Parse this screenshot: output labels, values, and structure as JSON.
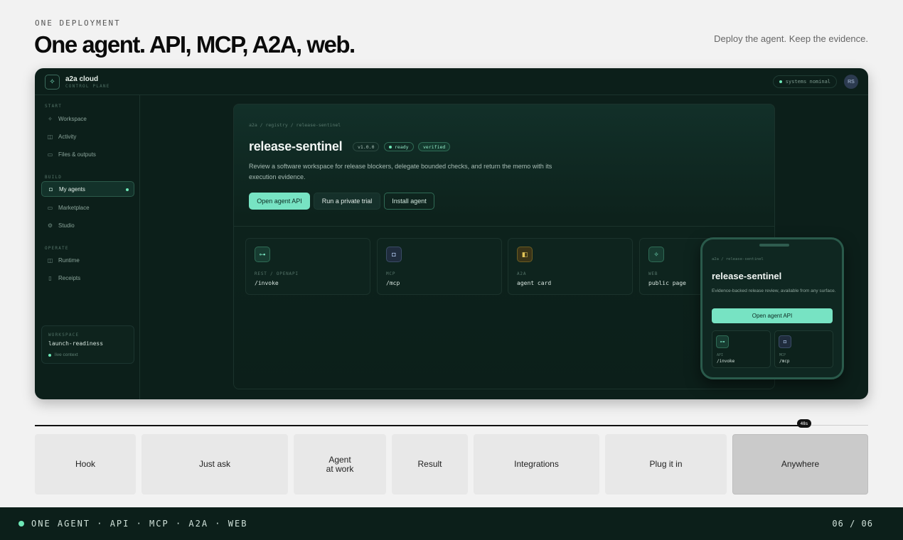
{
  "header": {
    "eyebrow": "ONE DEPLOYMENT",
    "headline": "One agent. API, MCP, A2A, web.",
    "tagline": "Deploy the agent. Keep the evidence."
  },
  "app": {
    "brand": {
      "name": "a2a cloud",
      "sub": "CONTROL PLANE",
      "icon": "sparkle-icon"
    },
    "status": "systems nominal",
    "avatar": "RS",
    "sidebar": {
      "sections": [
        {
          "label": "START",
          "items": [
            {
              "label": "Workspace",
              "icon": "sparkle-icon"
            },
            {
              "label": "Activity",
              "icon": "panel-icon"
            },
            {
              "label": "Files & outputs",
              "icon": "folder-icon"
            }
          ]
        },
        {
          "label": "BUILD",
          "items": [
            {
              "label": "My agents",
              "icon": "bot-icon",
              "active": true
            },
            {
              "label": "Marketplace",
              "icon": "folder-icon"
            },
            {
              "label": "Studio",
              "icon": "gear-icon"
            }
          ]
        },
        {
          "label": "OPERATE",
          "items": [
            {
              "label": "Runtime",
              "icon": "panel-icon"
            },
            {
              "label": "Receipts",
              "icon": "document-icon"
            }
          ]
        }
      ],
      "workspace": {
        "label": "WORKSPACE",
        "name": "launch-readiness",
        "status": "live context"
      }
    },
    "agent": {
      "breadcrumb": "a2a / registry / release-sentinel",
      "name": "release-sentinel",
      "version": "v1.0.0",
      "status": "ready",
      "verified": "verified",
      "description": "Review a software workspace for release blockers, delegate bounded checks, and return the memo with its execution evidence.",
      "buttons": {
        "primary": "Open agent API",
        "secondary": "Run a private trial",
        "install": "Install agent"
      },
      "endpoints": [
        {
          "label": "REST / OPENAPI",
          "value": "/invoke",
          "icon": "key-icon"
        },
        {
          "label": "MCP",
          "value": "/mcp",
          "icon": "bot-icon"
        },
        {
          "label": "A2A",
          "value": "agent card",
          "icon": "card-icon"
        },
        {
          "label": "WEB",
          "value": "public page",
          "icon": "sparkle-icon"
        }
      ]
    },
    "phone": {
      "breadcrumb": "a2a / release-sentinel",
      "title": "release-sentinel",
      "description": "Evidence-backed release review, available from any surface.",
      "button": "Open agent API",
      "cards": [
        {
          "label": "API",
          "value": "/invoke",
          "icon": "key-icon"
        },
        {
          "label": "MCP",
          "value": "/mcp",
          "icon": "bot-icon"
        }
      ]
    }
  },
  "timeline": {
    "time": "48s",
    "progress": 0.92,
    "chapters": [
      "Hook",
      "Just ask",
      "Agent\nat work",
      "Result",
      "Integrations",
      "Plug it in",
      "Anywhere"
    ],
    "active_index": 6
  },
  "footer": {
    "text": "ONE AGENT · API · MCP · A2A · WEB",
    "page": "06 / 06"
  },
  "colors": {
    "accent": "#77e3c3",
    "dark": "#0c1f1a"
  }
}
